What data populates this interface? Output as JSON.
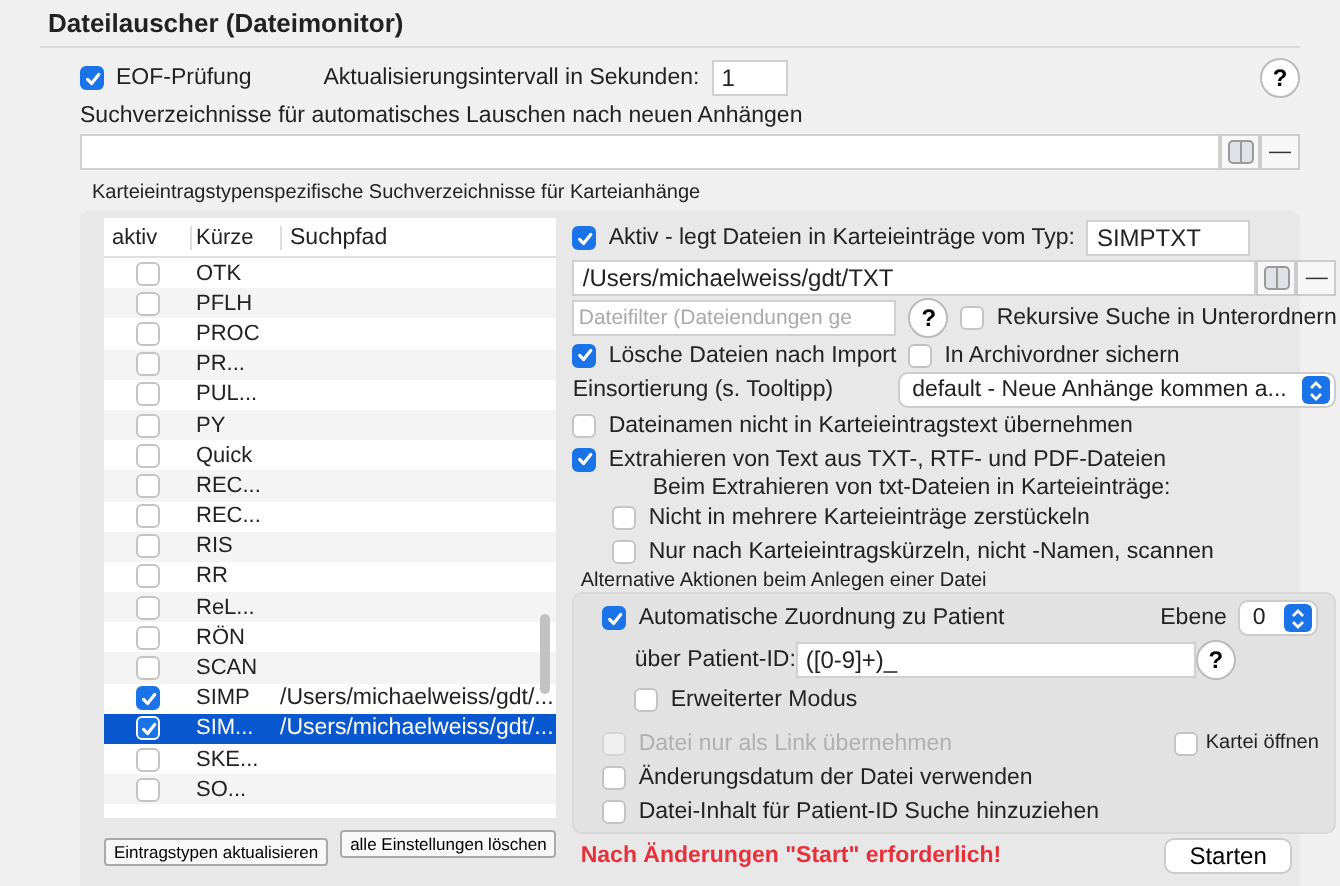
{
  "section_title": "Dateilauscher (Dateimonitor)",
  "eof": {
    "label": "EOF-Prüfung",
    "checked": true
  },
  "interval": {
    "label": "Aktualisierungsintervall in Sekunden:",
    "value": "1"
  },
  "help": "?",
  "search_dirs": {
    "label": "Suchverzeichnisse für automatisches Lauschen nach neuen Anhängen",
    "remove": "—"
  },
  "group_title": "Karteieintragstypenspezifische Suchverzeichnisse für Karteianhänge",
  "table": {
    "columns": [
      "aktiv",
      "Kürze",
      "Suchpfad"
    ],
    "rows": [
      {
        "active": false,
        "short": "OTK",
        "selected": false
      },
      {
        "active": false,
        "short": "PFLH",
        "selected": false
      },
      {
        "active": false,
        "short": "PROC",
        "selected": false
      },
      {
        "active": false,
        "short": "PR...",
        "selected": false
      },
      {
        "active": false,
        "short": "PUL...",
        "selected": false
      },
      {
        "active": false,
        "short": "PY",
        "selected": false
      },
      {
        "active": false,
        "short": "Quick",
        "selected": false
      },
      {
        "active": false,
        "short": "REC...",
        "selected": false
      },
      {
        "active": false,
        "short": "REC...",
        "selected": false
      },
      {
        "active": false,
        "short": "RIS",
        "selected": false
      },
      {
        "active": false,
        "short": "RR",
        "selected": false
      },
      {
        "active": false,
        "short": "ReL...",
        "selected": false
      },
      {
        "active": false,
        "short": "RÖN",
        "selected": false
      },
      {
        "active": false,
        "short": "SCAN",
        "selected": false
      },
      {
        "active": true,
        "short": "SIMP",
        "path": "/Users/michaelweiss/gdt/...",
        "selected": false
      },
      {
        "active": true,
        "short": "SIM...",
        "path": "/Users/michaelweiss/gdt/...",
        "selected": true
      },
      {
        "active": false,
        "short": "SKE...",
        "selected": false
      },
      {
        "active": false,
        "short": "SO...",
        "selected": false
      }
    ]
  },
  "list_buttons": [
    "Eintragstypen aktualisieren",
    "alle Einstellungen löschen"
  ],
  "detail": {
    "active": {
      "label": "Aktiv - legt Dateien in Karteieinträge vom Typ:",
      "checked": true
    },
    "type_value": "SIMPTXT",
    "path_value": "/Users/michaelweiss/gdt/TXT",
    "path_remove": "—",
    "filter_placeholder": "Dateifilter (Dateiendungen ge",
    "help": "?",
    "recursive": {
      "label": "Rekursive Suche in Unterordnern",
      "checked": false
    },
    "delete": {
      "label": "Lösche Dateien nach Import",
      "checked": true
    },
    "archive": {
      "label": "In Archivordner sichern",
      "checked": false
    },
    "sort_label": "Einsortierung (s. Tooltipp)",
    "sort_value": "default - Neue Anhänge kommen a...",
    "no_filename": {
      "label": "Dateinamen nicht in Karteieintragstext übernehmen",
      "checked": false
    },
    "extract": {
      "label": "Extrahieren von Text aus TXT-, RTF- und PDF-Dateien",
      "checked": true
    },
    "extract_note": "Beim Extrahieren von txt-Dateien in Karteieinträge:",
    "extract_options": [
      {
        "label": "Nicht in mehrere Karteieinträge zerstückeln",
        "checked": false
      },
      {
        "label": "Nur nach Karteieintragskürzeln, nicht -Namen, scannen",
        "checked": false
      }
    ]
  },
  "alternative": {
    "title": "Alternative Aktionen beim Anlegen einer Datei",
    "auto_assign": {
      "label": "Automatische Zuordnung zu Patient",
      "checked": true
    },
    "level_label": "Ebene",
    "level_value": "0",
    "patient_id_label": "über Patient-ID:",
    "patient_id_value": "([0-9]+)_",
    "help": "?",
    "extended": {
      "label": "Erweiterter Modus",
      "checked": false
    },
    "link_only": {
      "label": "Datei nur als Link übernehmen",
      "checked": false,
      "disabled": true
    },
    "open_file": {
      "label": "Kartei öffnen",
      "checked": false,
      "disabled": false
    },
    "options": [
      {
        "label": "Änderungsdatum der Datei verwenden",
        "checked": false,
        "disabled": false
      },
      {
        "label": "Datei-Inhalt für Patient-ID Suche hinzuziehen",
        "checked": false,
        "disabled": false
      }
    ]
  },
  "warning": "Nach Änderungen \"Start\" erforderlich!",
  "start_button": "Starten"
}
